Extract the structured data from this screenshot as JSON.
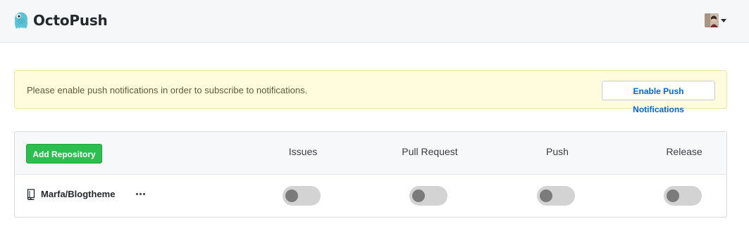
{
  "app": {
    "name": "OctoPush",
    "logo_icon": "octopus-logo-icon",
    "accent_color": "#5cc3d6"
  },
  "user_menu": {
    "avatar_icon": "user-avatar-icon",
    "caret_icon": "caret-down-icon"
  },
  "alert": {
    "message": "Please enable push notifications in order to subscribe to notifications.",
    "button_label": "Enable Push Notifications",
    "background_color": "#fffbdd"
  },
  "repositories": {
    "add_button_label": "Add Repository",
    "add_button_color": "#2cbe4e",
    "columns": [
      "Issues",
      "Pull Request",
      "Push",
      "Release"
    ],
    "rows": [
      {
        "name": "Marfa/Blogtheme",
        "icon": "repo-book-icon",
        "more_icon": "more-horizontal-icon",
        "issues": false,
        "pull_request": false,
        "push": false,
        "release": false
      }
    ]
  }
}
